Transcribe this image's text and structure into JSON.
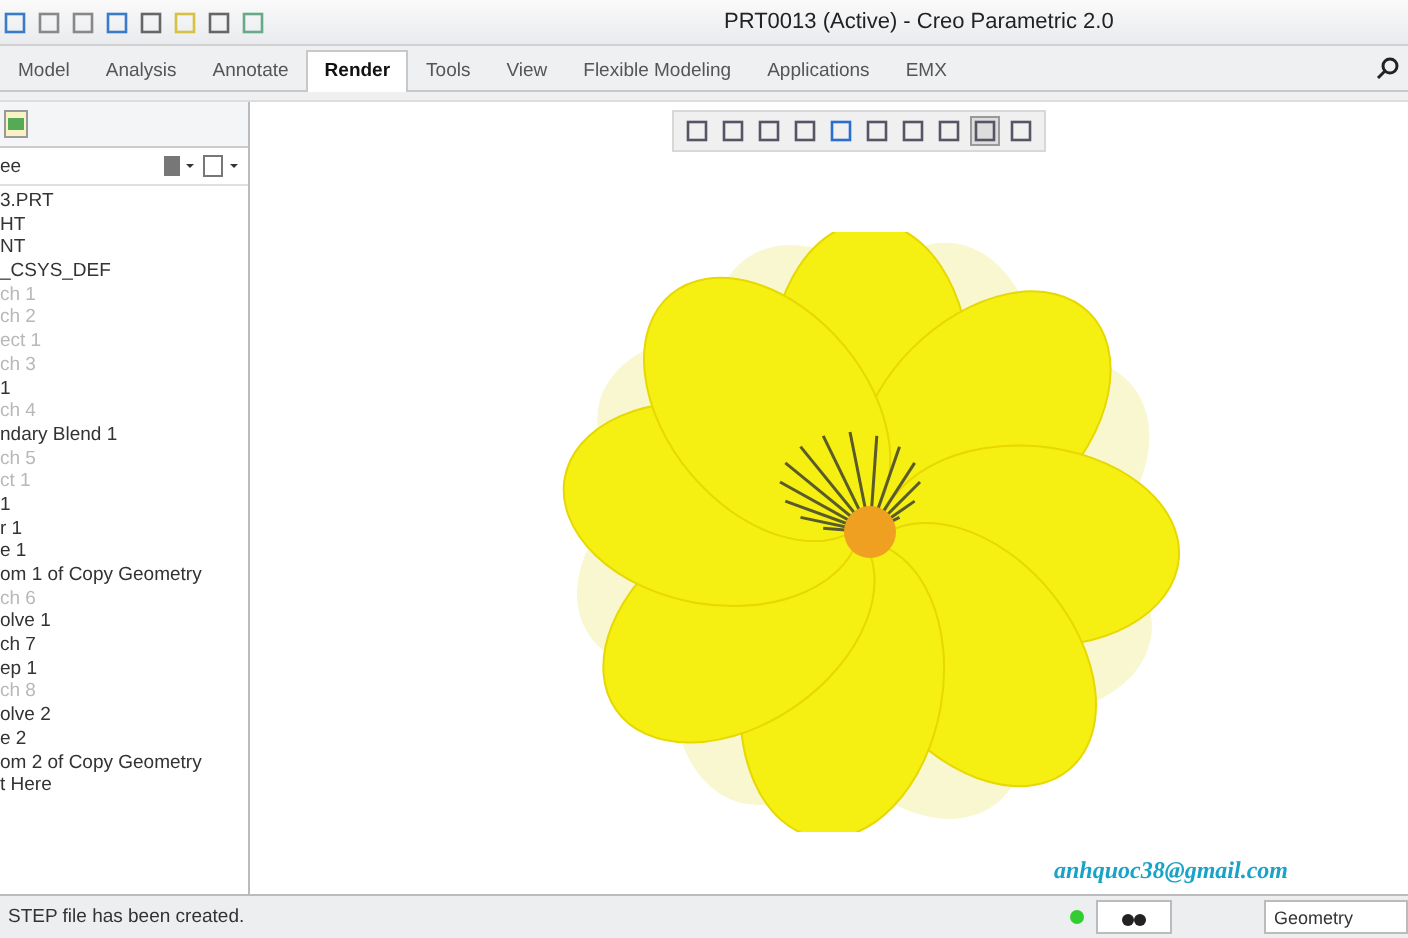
{
  "window": {
    "title": "PRT0013 (Active) - Creo Parametric 2.0"
  },
  "tabs": [
    {
      "label": "Model",
      "selected": false
    },
    {
      "label": "Analysis",
      "selected": false
    },
    {
      "label": "Annotate",
      "selected": false
    },
    {
      "label": "Render",
      "selected": true
    },
    {
      "label": "Tools",
      "selected": false
    },
    {
      "label": "View",
      "selected": false
    },
    {
      "label": "Flexible Modeling",
      "selected": false
    },
    {
      "label": "Applications",
      "selected": false
    },
    {
      "label": "EMX",
      "selected": false
    }
  ],
  "model_tree": {
    "header": "ee",
    "items": [
      {
        "label": "3.PRT",
        "suppressed": false
      },
      {
        "label": "HT",
        "suppressed": false
      },
      {
        "label": "NT",
        "suppressed": false
      },
      {
        "label": "_CSYS_DEF",
        "suppressed": false
      },
      {
        "label": "ch 1",
        "suppressed": true
      },
      {
        "label": "ch 2",
        "suppressed": true
      },
      {
        "label": "ect 1",
        "suppressed": true
      },
      {
        "label": "ch 3",
        "suppressed": true
      },
      {
        "label": "1",
        "suppressed": false
      },
      {
        "label": "ch 4",
        "suppressed": true
      },
      {
        "label": "ndary Blend 1",
        "suppressed": false
      },
      {
        "label": "ch 5",
        "suppressed": true
      },
      {
        "label": "ct 1",
        "suppressed": true
      },
      {
        "label": "1",
        "suppressed": false
      },
      {
        "label": "r 1",
        "suppressed": false
      },
      {
        "label": "e 1",
        "suppressed": false
      },
      {
        "label": "om 1 of Copy Geometry",
        "suppressed": false
      },
      {
        "label": "ch 6",
        "suppressed": true
      },
      {
        "label": "olve 1",
        "suppressed": false
      },
      {
        "label": "ch 7",
        "suppressed": false
      },
      {
        "label": "ep 1",
        "suppressed": false
      },
      {
        "label": "ch 8",
        "suppressed": true
      },
      {
        "label": "olve 2",
        "suppressed": false
      },
      {
        "label": "e 2",
        "suppressed": false
      },
      {
        "label": "om 2 of Copy Geometry",
        "suppressed": false
      },
      {
        "label": "t Here",
        "suppressed": false
      }
    ]
  },
  "canvas": {
    "signature": "anhquoc38@gmail.com"
  },
  "status_bar": {
    "message": "STEP file has been created.",
    "filter": "Geometry"
  }
}
